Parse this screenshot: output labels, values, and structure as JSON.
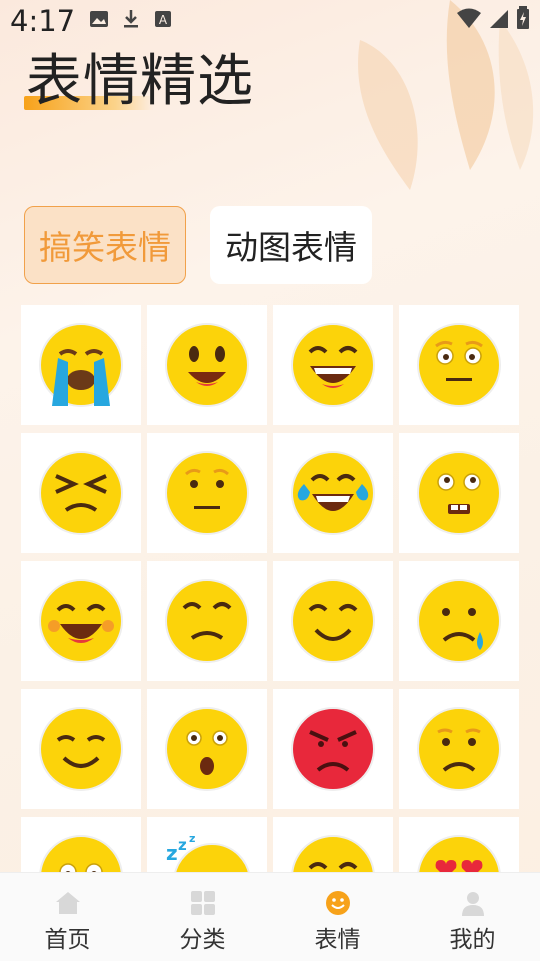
{
  "status_bar": {
    "time": "4:17",
    "left_icons": [
      "image-icon",
      "download-icon",
      "text-icon"
    ],
    "right_icons": [
      "wifi-icon",
      "signal-icon",
      "battery-icon"
    ]
  },
  "header": {
    "title": "表情精选"
  },
  "tabs": [
    {
      "label": "搞笑表情",
      "active": true
    },
    {
      "label": "动图表情",
      "active": false
    }
  ],
  "grid": {
    "columns": 4,
    "items": [
      {
        "name": "crying-emoji"
      },
      {
        "name": "happy-emoji"
      },
      {
        "name": "grinning-emoji"
      },
      {
        "name": "neutral-emoji"
      },
      {
        "name": "annoyed-emoji"
      },
      {
        "name": "straight-face-emoji"
      },
      {
        "name": "tears-of-joy-emoji"
      },
      {
        "name": "nervous-emoji"
      },
      {
        "name": "laughing-emoji"
      },
      {
        "name": "unamused-emoji"
      },
      {
        "name": "smiling-emoji"
      },
      {
        "name": "sad-tear-emoji"
      },
      {
        "name": "content-emoji"
      },
      {
        "name": "surprised-emoji"
      },
      {
        "name": "angry-emoji"
      },
      {
        "name": "frowning-emoji"
      },
      {
        "name": "worried-emoji"
      },
      {
        "name": "sleeping-emoji"
      },
      {
        "name": "grin-emoji"
      },
      {
        "name": "heart-eyes-emoji"
      }
    ]
  },
  "bottom_nav": [
    {
      "label": "首页",
      "icon": "home-icon",
      "active": false
    },
    {
      "label": "分类",
      "icon": "grid-icon",
      "active": false
    },
    {
      "label": "表情",
      "icon": "smile-icon",
      "active": true
    },
    {
      "label": "我的",
      "icon": "person-icon",
      "active": false
    }
  ],
  "colors": {
    "accent": "#f19a3a",
    "face": "#fcd30a",
    "angry": "#e8283b"
  }
}
